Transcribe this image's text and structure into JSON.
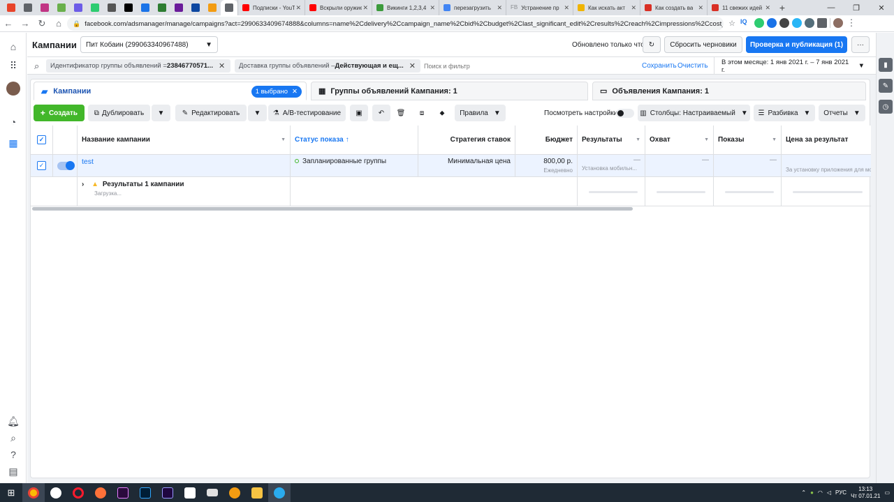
{
  "browser": {
    "tabs": [
      {
        "title": "Подписки - YouTube",
        "color": "#ff0000"
      },
      {
        "title": "Вскрыли оружие",
        "color": "#ff0000"
      },
      {
        "title": "Викинги 1,2,3,4",
        "color": "#3c9b3c"
      },
      {
        "title": "перезагрузить",
        "color": "#4285f4"
      },
      {
        "title": "Устранение пр",
        "color": "#8a8d91",
        "prefix": "FB"
      },
      {
        "title": "Как искать акт",
        "color": "#f0b400"
      },
      {
        "title": "Как создать ва",
        "color": "#d93025"
      },
      {
        "title": "11 свежих идей",
        "color": "#d93025"
      }
    ],
    "pinned_colors": [
      "#e8442a",
      "#5f6368",
      "#c13584",
      "#6ab04c",
      "#6c5ce7",
      "#2ecc71",
      "#555",
      "#000",
      "#1a73e8",
      "#2e7d32",
      "#6a1b9a",
      "#0d47a1",
      "#f39c12",
      "#5f6368"
    ],
    "new_tab": "+",
    "url": "facebook.com/adsmanager/manage/campaigns?act=2990633409674888&columns=name%2Cdelivery%2Ccampaign_name%2Cbid%2Cbudget%2Clast_significant_edit%2Cresults%2Creach%2Cimpressions%2Ccost_per...",
    "ext_iq": "IQ"
  },
  "header": {
    "title": "Кампании",
    "account": "Пит Кобаин (299063340967488)",
    "status_text": "Обновлено только что",
    "discard_label": "Сбросить черновики",
    "publish_label": "Проверка и публикация (1)",
    "more_label": "···"
  },
  "filters": {
    "chip1_label": "Идентификатор группы объявлений = ",
    "chip1_value": "23846770571...",
    "chip2_label": "Доставка группы объявлений – ",
    "chip2_value": "Действующая и ещ...",
    "search_placeholder": "Поиск и фильтр",
    "save_label": "Сохранить",
    "clear_label": "Очистить",
    "date_range": "В этом месяце: 1 янв 2021 г. – 7 янв 2021 г."
  },
  "tabs": {
    "campaigns": "Кампании",
    "selected_badge": "1 выбрано",
    "adsets": "Группы объявлений Кампания: 1",
    "ads": "Объявления Кампания: 1"
  },
  "actions": {
    "create": "Создать",
    "duplicate": "Дублировать",
    "edit": "Редактировать",
    "ab_test": "A/B-тестирование",
    "rules": "Правила",
    "view_settings": "Посмотреть настройки",
    "columns": "Столбцы: Настраиваемый",
    "breakdown": "Разбивка",
    "reports": "Отчеты"
  },
  "table": {
    "headers": {
      "name": "Название кампании",
      "delivery": "Статус показа",
      "bid": "Стратегия ставок",
      "budget": "Бюджет",
      "results": "Результаты",
      "reach": "Охват",
      "impressions": "Показы",
      "cost": "Цена за результат"
    },
    "row": {
      "name": "test",
      "delivery": "Запланированные группы",
      "bid": "Минимальная цена",
      "budget": "800,00 р.",
      "budget_sub": "Ежедневно",
      "results": "—",
      "results_sub": "Установка мобильн...",
      "reach": "—",
      "impressions": "—",
      "cost_sub": "За установку приложения для мо"
    },
    "summary": {
      "label": "Результаты 1 кампании",
      "sub": "Загрузка..."
    }
  },
  "taskbar": {
    "time": "13:13",
    "date": "Чт 07.01.21",
    "lang": "РУС"
  }
}
